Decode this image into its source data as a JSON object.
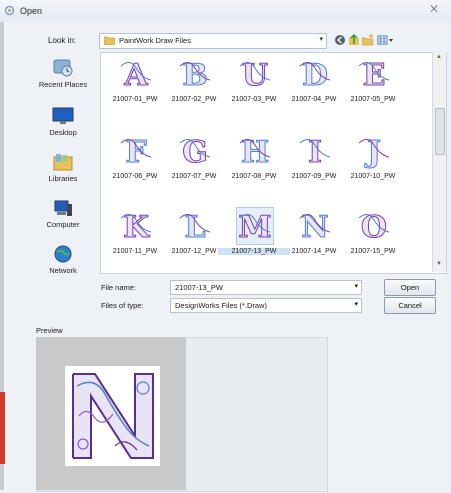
{
  "window": {
    "title": "Open",
    "close_glyph": "⨉"
  },
  "toolbar": {
    "look_in_label": "Look in:",
    "look_in_value": "PaintWork Draw Files",
    "icons": [
      "back-icon",
      "up-folder-icon",
      "new-folder-icon",
      "view-menu-icon"
    ]
  },
  "places": [
    {
      "label": "Recent Places",
      "icon": "recent-places-icon"
    },
    {
      "label": "Desktop",
      "icon": "desktop-icon"
    },
    {
      "label": "Libraries",
      "icon": "libraries-icon"
    },
    {
      "label": "Computer",
      "icon": "computer-icon"
    },
    {
      "label": "Network",
      "icon": "network-icon"
    }
  ],
  "files": [
    {
      "name": "21007-01_PW",
      "letter": "A"
    },
    {
      "name": "21007-02_PW",
      "letter": "B"
    },
    {
      "name": "21007-03_PW",
      "letter": "U"
    },
    {
      "name": "21007-04_PW",
      "letter": "D"
    },
    {
      "name": "21007-05_PW",
      "letter": "E"
    },
    {
      "name": "21007-06_PW",
      "letter": "F"
    },
    {
      "name": "21007-07_PW",
      "letter": "G"
    },
    {
      "name": "21007-08_PW",
      "letter": "H"
    },
    {
      "name": "21007-09_PW",
      "letter": "I"
    },
    {
      "name": "21007-10_PW",
      "letter": "J"
    },
    {
      "name": "21007-11_PW",
      "letter": "K"
    },
    {
      "name": "21007-12_PW",
      "letter": "L"
    },
    {
      "name": "21007-13_PW",
      "letter": "M",
      "selected": true
    },
    {
      "name": "21007-14_PW",
      "letter": "N"
    },
    {
      "name": "21007-15_PW",
      "letter": "O"
    }
  ],
  "form": {
    "file_name_label": "File name:",
    "file_name_value": "21007-13_PW",
    "file_type_label": "Files of type:",
    "file_type_value": "DesignWorks Files (*.Draw)",
    "open_label": "Open",
    "cancel_label": "Cancel"
  },
  "preview": {
    "label": "Preview"
  },
  "colors": {
    "design_purple": "#7a3fb0",
    "design_blue": "#4f7fd0",
    "selection": "#cfe0f5"
  }
}
